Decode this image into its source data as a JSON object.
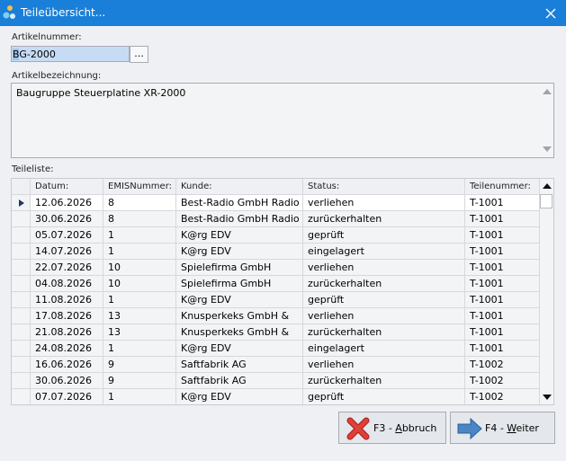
{
  "window": {
    "title": "Teileübersicht..."
  },
  "article": {
    "number_label": "Artikelnummer:",
    "number_value_first": "B",
    "number_value_rest": "G-2000",
    "browse_button": "...",
    "description_label": "Artikelbezeichnung:",
    "description_value": "Baugruppe Steuerplatine XR-2000"
  },
  "parts": {
    "label": "Teileliste:",
    "columns": [
      "Datum:",
      "EMISNummer:",
      "Kunde:",
      "Status:",
      "Teilenummer:"
    ],
    "rows": [
      [
        "12.06.2026",
        "8",
        "Best-Radio GmbH Radio",
        "verliehen",
        "T-1001"
      ],
      [
        "30.06.2026",
        "8",
        "Best-Radio GmbH Radio",
        "zurückerhalten",
        "T-1001"
      ],
      [
        "05.07.2026",
        "1",
        "K@rg EDV",
        "geprüft",
        "T-1001"
      ],
      [
        "14.07.2026",
        "1",
        "K@rg EDV",
        "eingelagert",
        "T-1001"
      ],
      [
        "22.07.2026",
        "10",
        "Spielefirma GmbH",
        "verliehen",
        "T-1001"
      ],
      [
        "04.08.2026",
        "10",
        "Spielefirma GmbH",
        "zurückerhalten",
        "T-1001"
      ],
      [
        "11.08.2026",
        "1",
        "K@rg EDV",
        "geprüft",
        "T-1001"
      ],
      [
        "17.08.2026",
        "13",
        "Knusperkeks GmbH &",
        "verliehen",
        "T-1001"
      ],
      [
        "21.08.2026",
        "13",
        "Knusperkeks GmbH &",
        "zurückerhalten",
        "T-1001"
      ],
      [
        "24.08.2026",
        "1",
        "K@rg EDV",
        "eingelagert",
        "T-1001"
      ],
      [
        "16.06.2026",
        "9",
        "Saftfabrik AG",
        "verliehen",
        "T-1002"
      ],
      [
        "30.06.2026",
        "9",
        "Saftfabrik AG",
        "zurückerhalten",
        "T-1002"
      ],
      [
        "07.07.2026",
        "1",
        "K@rg EDV",
        "geprüft",
        "T-1002"
      ]
    ]
  },
  "buttons": {
    "cancel_prefix": "F3 - ",
    "cancel_underlined": "A",
    "cancel_rest": "bbruch",
    "next_prefix": "F4 - ",
    "next_underlined": "W",
    "next_rest": "eiter"
  },
  "icons": {
    "app": "app-icon",
    "close": "close-icon",
    "cancel": "red-x-icon",
    "next": "arrow-right-icon"
  },
  "colors": {
    "titlebar": "#1a7fd8",
    "selection": "#9ec4ee",
    "grid_current_row": "#ffffff",
    "cancel_icon": "#e0403a",
    "next_icon": "#4a86c6"
  }
}
